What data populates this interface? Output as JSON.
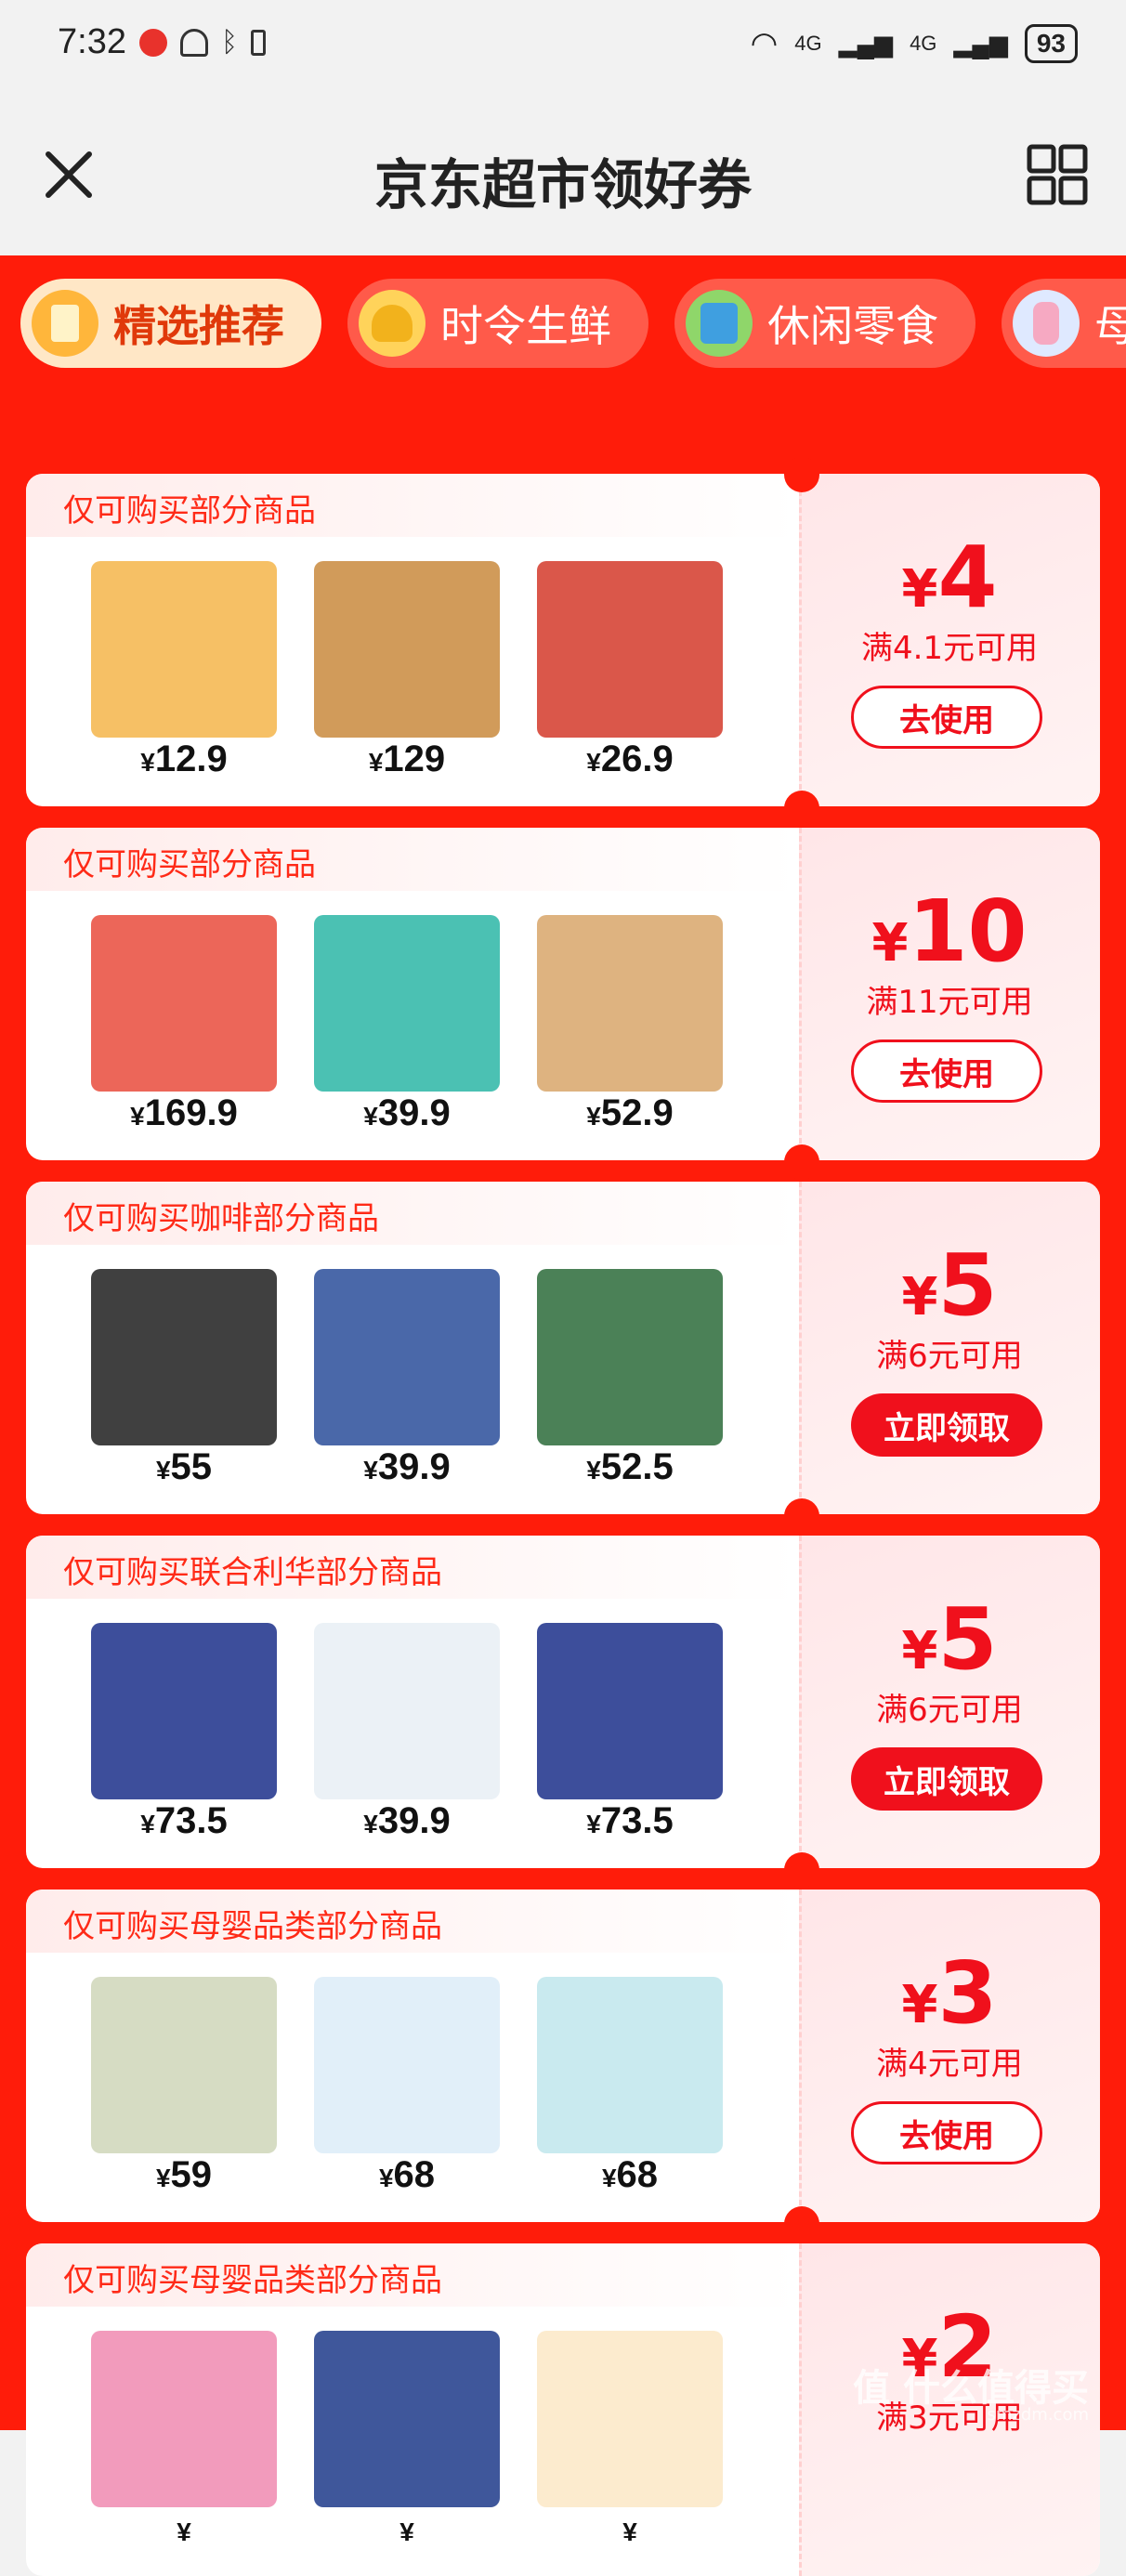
{
  "status_bar": {
    "time": "7:32",
    "network_1": "4G",
    "network_2": "4G",
    "battery": "93"
  },
  "nav": {
    "title": "京东超市领好券"
  },
  "tabs": [
    {
      "label": "精选推荐",
      "active": true
    },
    {
      "label": "时令生鲜",
      "active": false
    },
    {
      "label": "休闲零食",
      "active": false
    },
    {
      "label": "母",
      "active": false
    }
  ],
  "coupons": [
    {
      "title": "仅可购买部分商品",
      "currency": "¥",
      "amount": "4",
      "condition": "满4.1元可用",
      "button": "去使用",
      "button_style": "outline",
      "products": [
        {
          "currency": "¥",
          "price": "12.9"
        },
        {
          "currency": "¥",
          "price": "129"
        },
        {
          "currency": "¥",
          "price": "26.9"
        }
      ]
    },
    {
      "title": "仅可购买部分商品",
      "currency": "¥",
      "amount": "10",
      "condition": "满11元可用",
      "button": "去使用",
      "button_style": "outline",
      "products": [
        {
          "currency": "¥",
          "price": "169.9"
        },
        {
          "currency": "¥",
          "price": "39.9"
        },
        {
          "currency": "¥",
          "price": "52.9"
        }
      ]
    },
    {
      "title": "仅可购买咖啡部分商品",
      "currency": "¥",
      "amount": "5",
      "condition": "满6元可用",
      "button": "立即领取",
      "button_style": "solid",
      "products": [
        {
          "currency": "¥",
          "price": "55"
        },
        {
          "currency": "¥",
          "price": "39.9"
        },
        {
          "currency": "¥",
          "price": "52.5"
        }
      ]
    },
    {
      "title": "仅可购买联合利华部分商品",
      "currency": "¥",
      "amount": "5",
      "condition": "满6元可用",
      "button": "立即领取",
      "button_style": "solid",
      "products": [
        {
          "currency": "¥",
          "price": "73.5"
        },
        {
          "currency": "¥",
          "price": "39.9"
        },
        {
          "currency": "¥",
          "price": "73.5"
        }
      ]
    },
    {
      "title": "仅可购买母婴品类部分商品",
      "currency": "¥",
      "amount": "3",
      "condition": "满4元可用",
      "button": "去使用",
      "button_style": "outline",
      "products": [
        {
          "currency": "¥",
          "price": "59"
        },
        {
          "currency": "¥",
          "price": "68"
        },
        {
          "currency": "¥",
          "price": "68"
        }
      ]
    },
    {
      "title": "仅可购买母婴品类部分商品",
      "currency": "¥",
      "amount": "2",
      "condition": "满3元可用",
      "button": "",
      "button_style": "outline",
      "products": [
        {
          "currency": "¥",
          "price": ""
        },
        {
          "currency": "¥",
          "price": ""
        },
        {
          "currency": "¥",
          "price": ""
        }
      ]
    }
  ],
  "watermark": {
    "text": "值 什么值得买",
    "url": "smzdm.com"
  },
  "colors": {
    "brand_red": "#ff1c0a",
    "coupon_red": "#f0101c",
    "active_tab_bg": "#ffe7c6"
  }
}
